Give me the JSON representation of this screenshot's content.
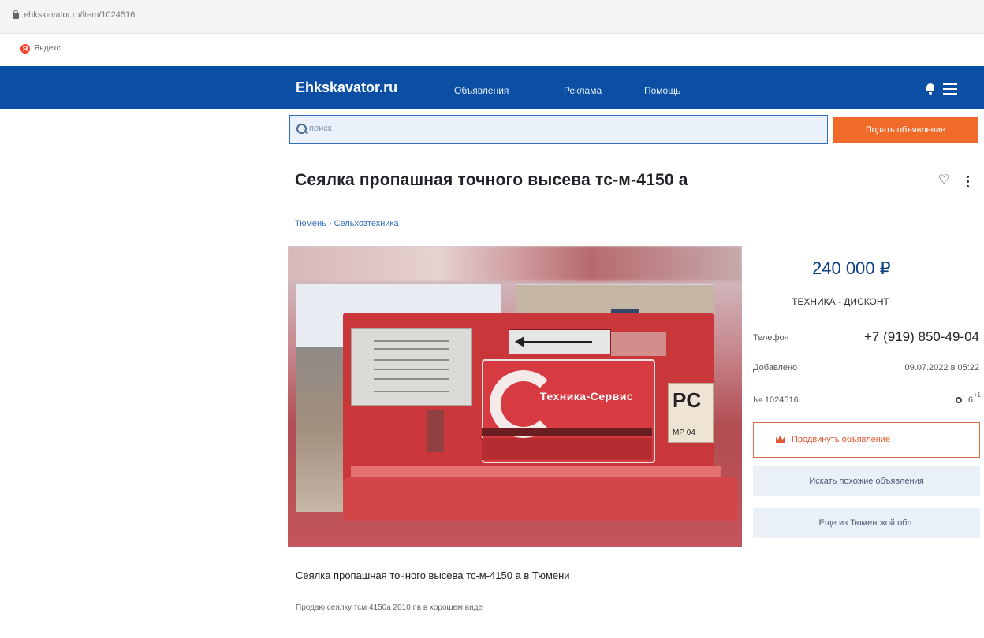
{
  "browser": {
    "url": "ehkskavator.ru/item/1024516",
    "bookmark": "Яндекс"
  },
  "header": {
    "logo": "Ehkskavator.ru",
    "nav": [
      "Объявления",
      "Реклама",
      "Помощь"
    ],
    "icons": [
      "bell-icon",
      "menu-icon"
    ],
    "colors": {
      "navbar": "#0b4fa4",
      "accent": "#f06a2a"
    }
  },
  "search": {
    "placeholder": "поиск",
    "submit_label": "Подать объявление"
  },
  "listing": {
    "title": "Сеялка пропашная точного высева тс-м-4150 а",
    "breadcrumb": {
      "city": "Тюмень",
      "separator": "›",
      "category": "Сельхозтехника"
    },
    "photo_plate_brand": "Техника-Сервис",
    "photo_plate_mark": "МР 04",
    "price": "240 000 ₽",
    "seller": "ТЕХНИКА - ДИСКОНТ",
    "phone_label": "Телефон",
    "phone": "+7 (919) 850-49-04",
    "added_label": "Добавлено",
    "added": "09.07.2022 в 05:22",
    "number": "№ 1024516",
    "views": "6",
    "views_delta": "+1",
    "promote_label": "Продвинуть объявление",
    "similar_label": "Искать похожие объявления",
    "more_label": "Еще из Тюменской обл.",
    "subtitle": "Сеялка пропашная точного высева тс-м-4150 а в Тюмени",
    "description": "Продаю сеялку тсм 4150а 2010 г.в в хорошем виде"
  }
}
